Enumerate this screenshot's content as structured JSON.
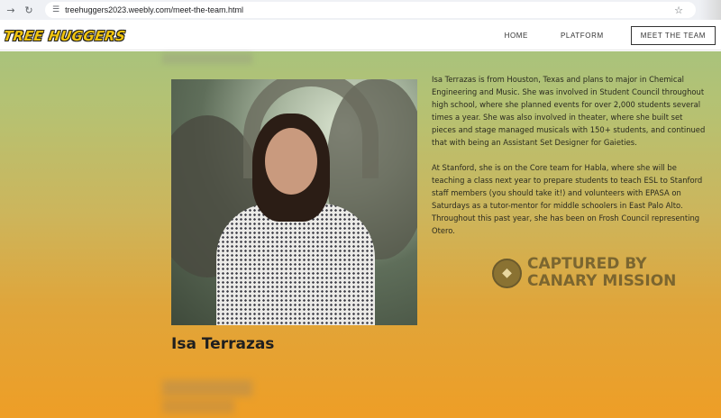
{
  "browser": {
    "url": "treehuggers2023.weebly.com/meet-the-team.html",
    "icons": [
      "back-icon",
      "reload-icon",
      "site-settings-icon",
      "bookmark-star-icon"
    ]
  },
  "header": {
    "logo_text": "TREE HUGGERS",
    "nav": [
      {
        "label": "HOME"
      },
      {
        "label": "PLATFORM"
      },
      {
        "label": "MEET THE TEAM",
        "active": true
      }
    ]
  },
  "member": {
    "name": "Isa Terrazas",
    "bio_paragraphs": [
      "Isa Terrazas is from Houston, Texas and plans to major in Chemical Engineering and Music. She was involved in Student Council throughout high school, where she planned events for over 2,000 students several times a year. She was also involved in theater, where she built set pieces and stage managed musicals with 150+ students, and continued that with being an Assistant Set Designer for Gaieties.",
      "At Stanford, she is on the Core team for Habla, where she will be teaching a class next year to prepare students to teach ESL to Stanford staff members (you should take it!) and volunteers with EPASA on Saturdays as a tutor-mentor for middle schoolers in East Palo Alto. Throughout this past year, she has been on Frosh Council representing Otero."
    ]
  },
  "watermark": {
    "line1": "CAPTURED BY",
    "line2": "CANARY MISSION"
  },
  "colors": {
    "gradient_top": "#a9c37c",
    "gradient_bottom": "#ee9e26",
    "logo": "#f1c40f"
  }
}
